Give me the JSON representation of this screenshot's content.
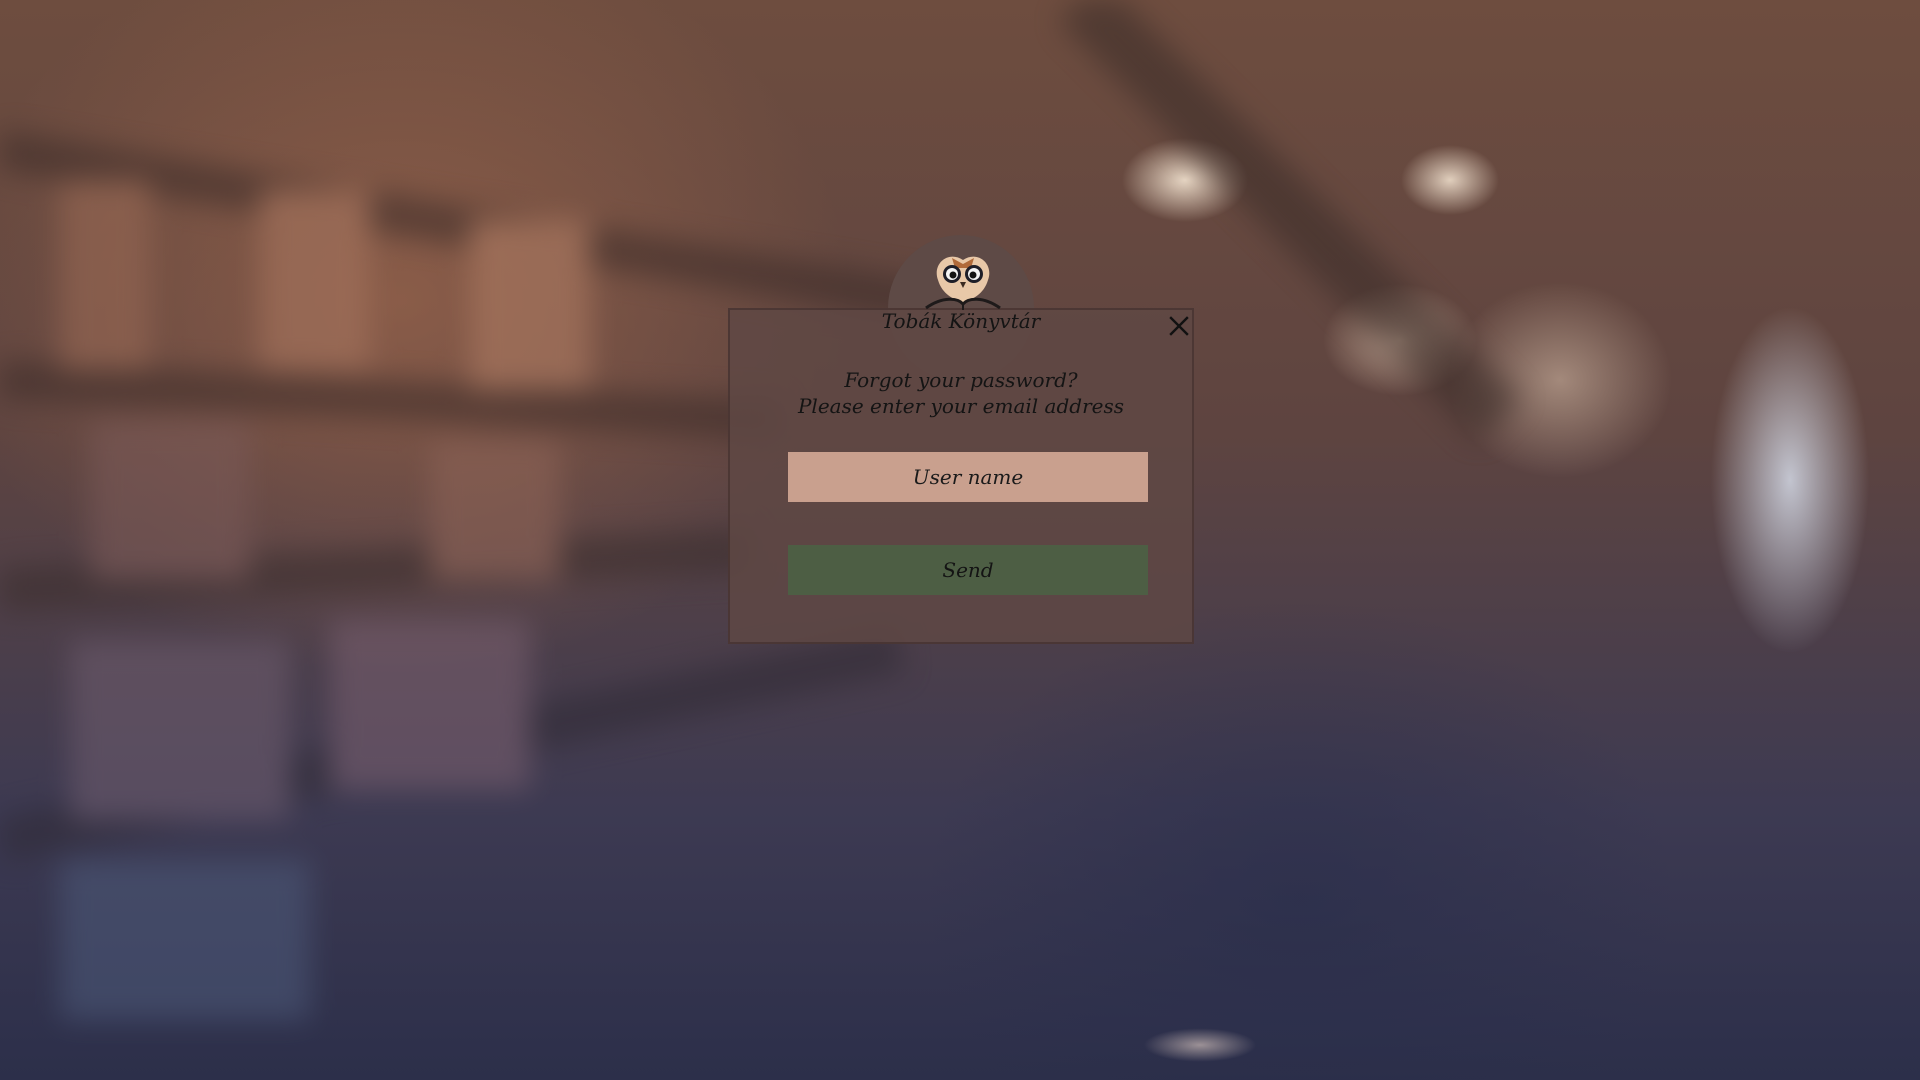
{
  "app": {
    "brand_name": "Tobák Könyvtár"
  },
  "dialog": {
    "prompt_line1": "Forgot your password?",
    "prompt_line2": "Please enter your email address",
    "username_placeholder": "User name",
    "username_value": "",
    "send_label": "Send",
    "close_icon": "close-icon",
    "logo_icon": "owl-book-icon"
  },
  "colors": {
    "modal_bg": "#5f4844",
    "input_bg": "#c9a08e",
    "send_bg": "#4d5e44",
    "text": "#141414"
  }
}
